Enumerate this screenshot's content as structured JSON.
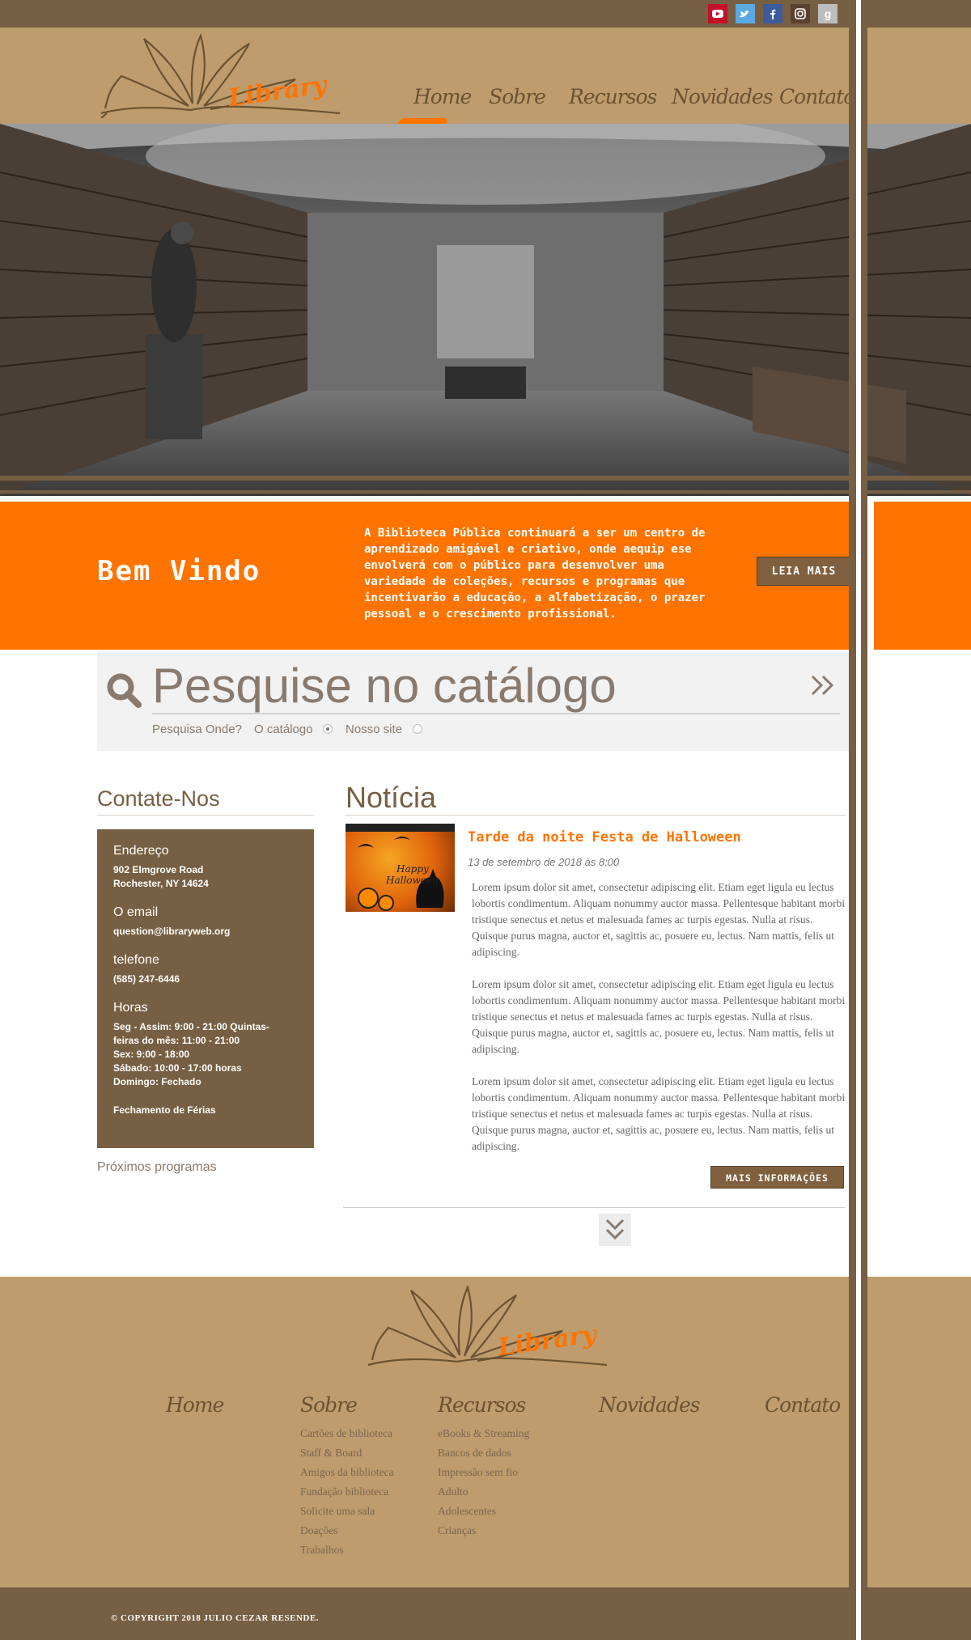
{
  "social": [
    "youtube-icon",
    "twitter-icon",
    "facebook-icon",
    "instagram-icon",
    "google-icon"
  ],
  "logo": {
    "text": "Library"
  },
  "nav": {
    "home": "Home",
    "sobre": "Sobre",
    "recursos": "Recursos",
    "novidades": "Novidades",
    "contato": "Contato"
  },
  "welcome": {
    "title": "Bem Vindo",
    "text": "A Biblioteca Pública continuará a ser um centro de aprendizado amigável e criativo, onde aequip ese envolverá com o público para desenvolver uma variedade de coleções, recursos e programas que incentivarão a educação, a alfabetização, o prazer pessoal e o crescimento profissional.",
    "button": "LEIA MAIS"
  },
  "search": {
    "placeholder": "Pesquise no catálogo",
    "go": "»",
    "where_label": "Pesquisa Onde?",
    "option1": "O catálogo",
    "option2": "Nosso site"
  },
  "contact": {
    "title": "Contate-Nos",
    "address_head": "Endereço",
    "address_line1": "902 Elmgrove Road",
    "address_line2": "Rochester, NY 14624",
    "email_head": "O email",
    "email": "question@libraryweb.org",
    "phone_head": "telefone",
    "phone": "(585) 247-6446",
    "hours_head": "Horas",
    "hours_line1": "Seg - Assim: 9:00 - 21:00 Quintas-",
    "hours_line2": "feiras do mês: 11:00 - 21:00",
    "hours_line3": "Sex: 9:00 - 18:00",
    "hours_line4": "Sábado: 10:00 - 17:00 horas",
    "hours_line5": "Domingo: Fechado",
    "holidays": "Fechamento de Férias",
    "next_programs": "Próximos programas"
  },
  "news": {
    "title": "Notícia",
    "headline": "Tarde da noite Festa de Halloween",
    "date": "13 de setembro de 2018 às 8:00",
    "paragraphs": [
      "Lorem ipsum dolor sit amet, consectetur adipiscing elit. Etiam eget ligula eu lectus lobortis condimentum. Aliquam nonummy auctor massa. Pellentesque habitant morbi tristique senectus et netus et malesuada fames ac turpis egestas. Nulla at risus. Quisque purus magna, auctor et, sagittis ac, posuere eu, lectus. Nam mattis, felis ut adipiscing.",
      "Lorem ipsum dolor sit amet, consectetur adipiscing elit. Etiam eget ligula eu lectus lobortis condimentum. Aliquam nonummy auctor massa. Pellentesque habitant morbi tristique senectus et netus et malesuada fames ac turpis egestas. Nulla at risus. Quisque purus magna, auctor et, sagittis ac, posuere eu, lectus. Nam mattis, felis ut adipiscing.",
      "Lorem ipsum dolor sit amet, consectetur adipiscing elit. Etiam eget ligula eu lectus lobortis condimentum. Aliquam nonummy auctor massa. Pellentesque habitant morbi tristique senectus et netus et malesuada fames ac turpis egestas. Nulla at risus. Quisque purus magna, auctor et, sagittis ac, posuere eu, lectus. Nam mattis, felis ut adipiscing."
    ],
    "image_text1": "Happy",
    "image_text2": "Halloween",
    "more_button": "MAIS INFORMAÇÕES"
  },
  "footer": {
    "nav": {
      "home": "Home",
      "sobre": "Sobre",
      "recursos": "Recursos",
      "novidades": "Novidades",
      "contato": "Contato"
    },
    "sobre_links": [
      "Cartões de biblioteca",
      "Staff & Board",
      "Amigos da biblioteca",
      "Fundação biblioteca",
      "Solicite uma sala",
      "Doações",
      "Trabalhos"
    ],
    "recursos_links": [
      "eBooks & Streaming",
      "Bancos de dados",
      "Impressão sem fio",
      "Adulto",
      "Adolescentes",
      "Crianças"
    ],
    "copyright": "© COPYRIGHT 2018 JULIO CEZAR RESENDE."
  },
  "colors": {
    "brown": "#775f43",
    "tan": "#bf9c6d",
    "orange": "#ff7300",
    "button": "#80603f"
  }
}
